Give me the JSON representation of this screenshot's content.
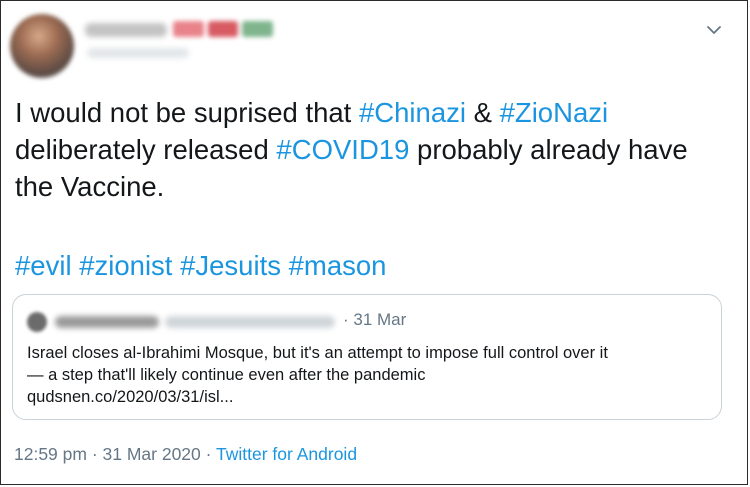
{
  "author": {
    "avatar_icon": "profile-avatar",
    "display_name": "",
    "handle": ""
  },
  "menu_icon": "chevron-down-icon",
  "tweet": {
    "lines": [
      [
        {
          "t": "I would not be suprised that "
        },
        {
          "t": "#Chinazi",
          "tag": true
        },
        {
          "t": " & "
        },
        {
          "t": "#ZioNazi",
          "tag": true
        }
      ],
      [
        {
          "t": " deliberately released "
        },
        {
          "t": "#COVID19",
          "tag": true
        },
        {
          "t": " probably already have"
        }
      ],
      [
        {
          "t": "the Vaccine."
        }
      ]
    ],
    "hashtags": [
      "#evil",
      "#zionist",
      "#Jesuits",
      "#mason"
    ]
  },
  "quoted_tweet": {
    "date": "· 31 Mar",
    "text_lines": [
      "Israel closes al-Ibrahimi Mosque, but it's an attempt to impose full control over it",
      "— a step that'll likely continue even after the pandemic",
      "qudsnen.co/2020/03/31/isl..."
    ]
  },
  "meta": {
    "time": "12:59 pm · 31 Mar 2020 · ",
    "source": "Twitter for Android"
  },
  "colors": {
    "link": "#1b95e0",
    "text": "#14171a",
    "muted": "#657786",
    "quote_border": "#c9d2d8"
  }
}
